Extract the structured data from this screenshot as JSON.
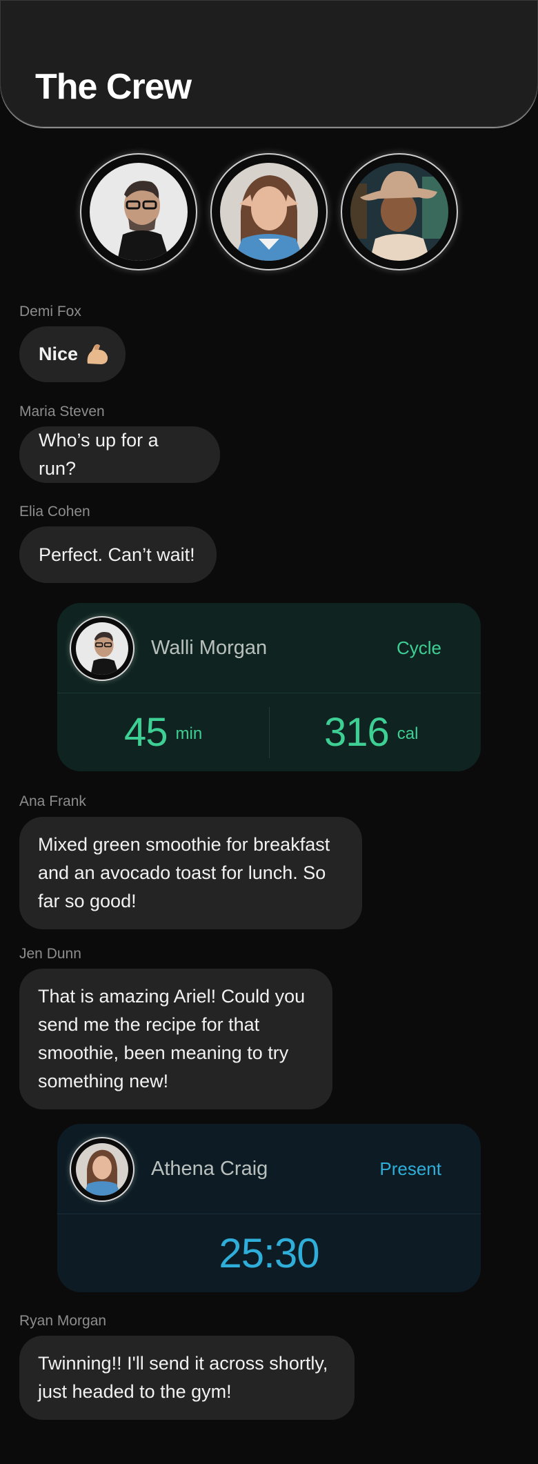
{
  "header": {
    "title": "The Crew"
  },
  "avatars": [
    {
      "name": "member-avatar-1",
      "icon": "man-glasses-photo"
    },
    {
      "name": "member-avatar-2",
      "icon": "woman-peace-sign-photo"
    },
    {
      "name": "member-avatar-3",
      "icon": "man-hat-photo"
    }
  ],
  "messages": [
    {
      "sender": "Demi Fox",
      "text": "Nice",
      "emoji": "flexed-biceps-icon"
    },
    {
      "sender": "Maria Steven",
      "text": "Who’s up for a run?"
    },
    {
      "sender": "Elia Cohen",
      "text": "Perfect. Can’t wait!"
    },
    {
      "sender": "Ana Frank",
      "lines": [
        "Mixed green smoothie for breakfast",
        "and an avocado toast for lunch. So",
        "far so good!"
      ]
    },
    {
      "sender": "Jen Dunn",
      "lines": [
        "That is amazing Ariel! Could you",
        "send me the recipe for that",
        "smoothie, been meaning to try",
        "something new!"
      ]
    },
    {
      "sender": "Ryan Morgan",
      "lines": [
        "Twinning!! I'll send it across shortly,",
        "just headed to the gym!"
      ]
    }
  ],
  "activity_cards": [
    {
      "name": "Walli  Morgan",
      "activity": "Cycle",
      "duration_value": "45",
      "duration_unit": "min",
      "calories_value": "316",
      "calories_unit": "cal",
      "accent": "#3ecf95",
      "bg": "#0f2420"
    },
    {
      "name": "Athena Craig",
      "activity": "Present",
      "timer": "25:30",
      "accent": "#2eaed9",
      "bg": "#0d1c24"
    }
  ]
}
